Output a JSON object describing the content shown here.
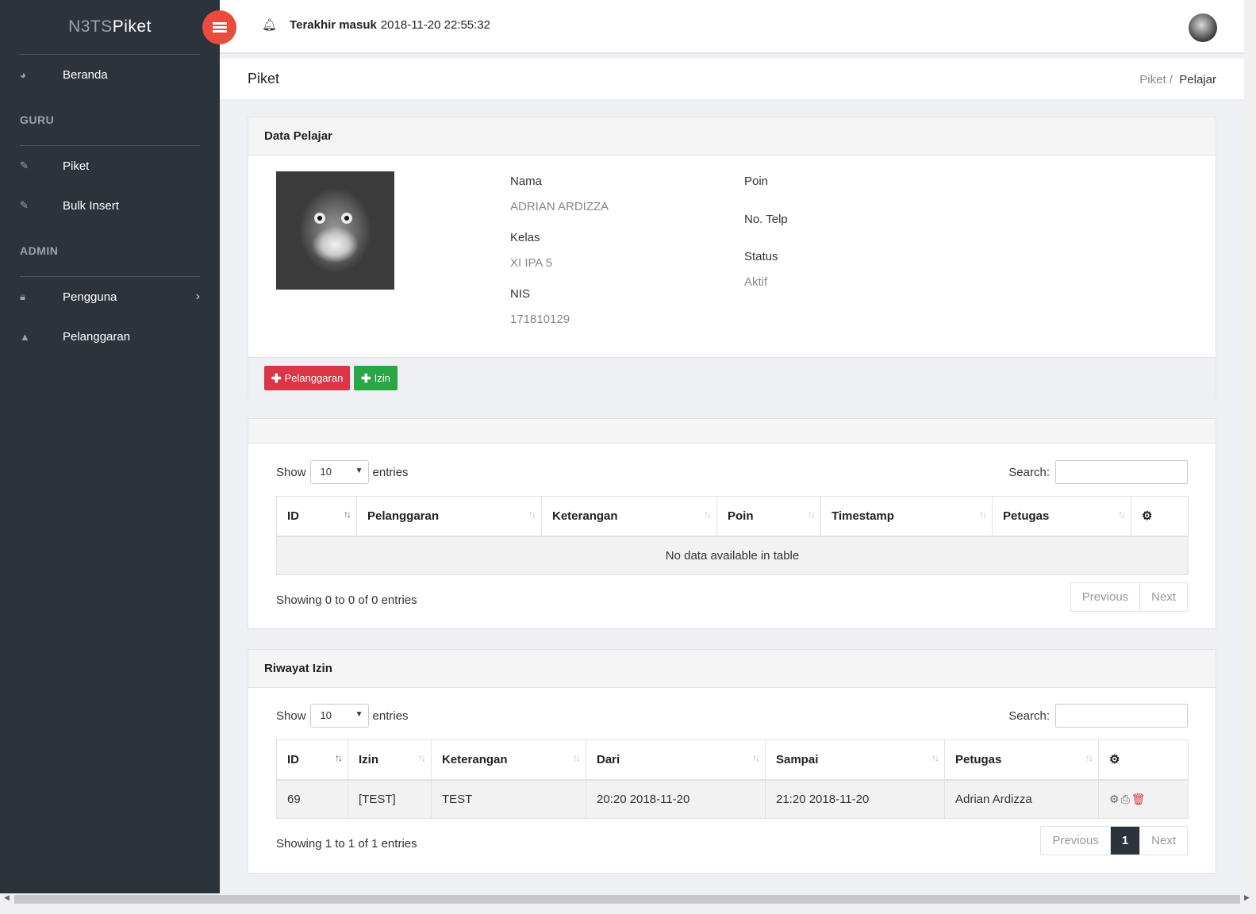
{
  "brand": {
    "part1": "N3TS",
    "part2": "Piket"
  },
  "topbar": {
    "last_login_label": "Terakhir masuk",
    "last_login_value": "2018-11-20 22:55:32"
  },
  "sidebar": {
    "items": [
      {
        "label": "Beranda",
        "icon": "dashboard-icon"
      },
      {
        "label": "Piket",
        "icon": "pencil-icon"
      },
      {
        "label": "Bulk Insert",
        "icon": "pencil-icon"
      },
      {
        "label": "Pengguna",
        "icon": "lock-icon"
      },
      {
        "label": "Pelanggaran",
        "icon": "warning-icon"
      }
    ],
    "sections": [
      "GURU",
      "ADMIN"
    ]
  },
  "page": {
    "title": "Piket",
    "breadcrumb": [
      "Piket",
      "Pelajar"
    ]
  },
  "student_card": {
    "title": "Data Pelajar",
    "labels": {
      "nama": "Nama",
      "kelas": "Kelas",
      "nis": "NIS",
      "poin": "Poin",
      "telp": "No. Telp",
      "status": "Status"
    },
    "values": {
      "nama": "ADRIAN ARDIZZA",
      "kelas": "XI IPA 5",
      "nis": "171810129",
      "poin": "",
      "telp": "",
      "status": "Aktif"
    },
    "buttons": {
      "pelanggaran": "Pelanggaran",
      "izin": "Izin"
    }
  },
  "violation_card": {
    "title": "",
    "show_label": "Show",
    "entries_label": "entries",
    "length_value": "10",
    "search_label": "Search:",
    "columns": [
      "ID",
      "Pelanggaran",
      "Keterangan",
      "Poin",
      "Timestamp",
      "Petugas"
    ],
    "empty_text": "No data available in table",
    "info": "Showing 0 to 0 of 0 entries",
    "pager": {
      "prev": "Previous",
      "next": "Next"
    }
  },
  "permit_card": {
    "title": "Riwayat Izin",
    "show_label": "Show",
    "entries_label": "entries",
    "length_value": "10",
    "search_label": "Search:",
    "columns": [
      "ID",
      "Izin",
      "Keterangan",
      "Dari",
      "Sampai",
      "Petugas"
    ],
    "rows": [
      {
        "id": "69",
        "izin": "[TEST]",
        "keterangan": "TEST",
        "dari": "20:20 2018-11-20",
        "sampai": "21:20 2018-11-20",
        "petugas": "Adrian Ardizza"
      }
    ],
    "info": "Showing 1 to 1 of 1 entries",
    "pager": {
      "prev": "Previous",
      "page": "1",
      "next": "Next"
    }
  },
  "colors": {
    "sidebar": "#2d333b",
    "accent": "#e84c3d",
    "danger": "#dc3545",
    "success": "#28a745"
  }
}
